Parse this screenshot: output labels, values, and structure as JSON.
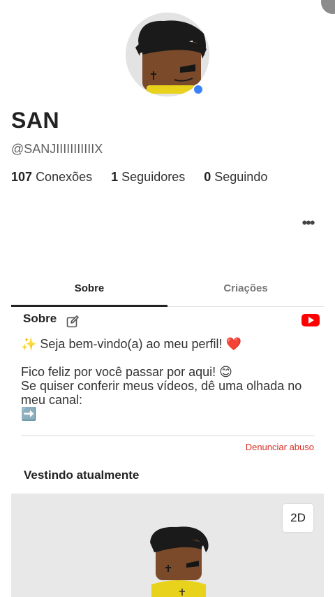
{
  "profile": {
    "display_name": "SAN",
    "username": "@SANJIIIIIIIIIIIX",
    "presence_color": "#3b82f6"
  },
  "stats": {
    "connections_count": "107",
    "connections_label": "Conexões",
    "followers_count": "1",
    "followers_label": "Seguidores",
    "following_count": "0",
    "following_label": "Seguindo"
  },
  "menu": {
    "more_label": "•••"
  },
  "tabs": [
    {
      "label": "Sobre",
      "active": true
    },
    {
      "label": "Criações",
      "active": false
    }
  ],
  "about": {
    "title": "Sobre",
    "bio": "✨ Seja bem-vindo(a) ao meu perfil! ❤️\n\nFico feliz por você passar por aqui! 😊\nSe quiser conferir meus vídeos, dê uma olhada no meu canal:\n➡️",
    "report_label": "Denunciar abuso"
  },
  "wearing": {
    "title": "Vestindo atualmente",
    "toggle_label": "2D"
  },
  "icons": {
    "edit": "edit-icon",
    "youtube": "youtube-icon",
    "more": "more-options-icon"
  },
  "colors": {
    "accent_red": "#d93025",
    "youtube_red": "#ff0000",
    "presence_blue": "#3b82f6"
  }
}
